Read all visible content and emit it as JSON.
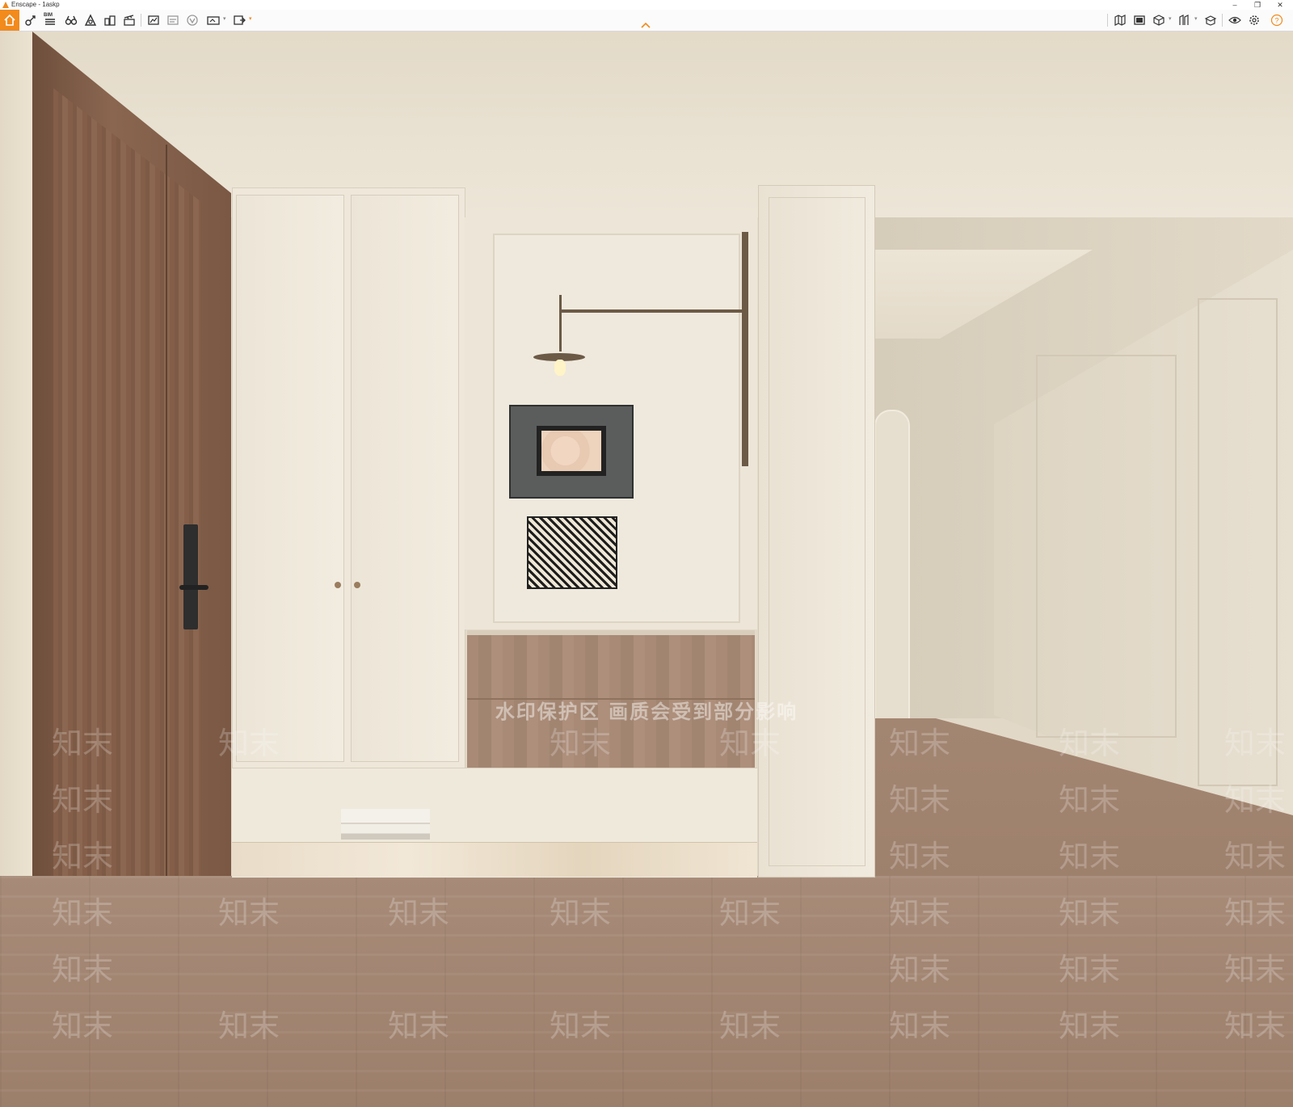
{
  "window": {
    "title": "Enscape - 1askp",
    "minimize": "–",
    "restore": "❐",
    "close": "✕"
  },
  "toolbar": {
    "home_icon": "home-icon",
    "bim_label": "BIM",
    "accent_color": "#f28a1c",
    "left_tools": [
      "sync-views-icon",
      "bim-list-icon",
      "binoculars-icon",
      "atmosphere-icon",
      "objects-icon",
      "video-editor-icon",
      "screenshot-icon",
      "batch-render-icon",
      "vr-icon",
      "panorama-360-icon",
      "export-exe-icon"
    ],
    "right_tools": [
      "map-icon",
      "gallery-icon",
      "asset-library-icon",
      "material-editor-icon",
      "collaboration-icon",
      "views-eye-icon",
      "settings-icon",
      "help-icon"
    ]
  },
  "scene": {
    "description_watermark": "水印保护区  画质会受到部分影响",
    "brand_watermark": "知末"
  }
}
